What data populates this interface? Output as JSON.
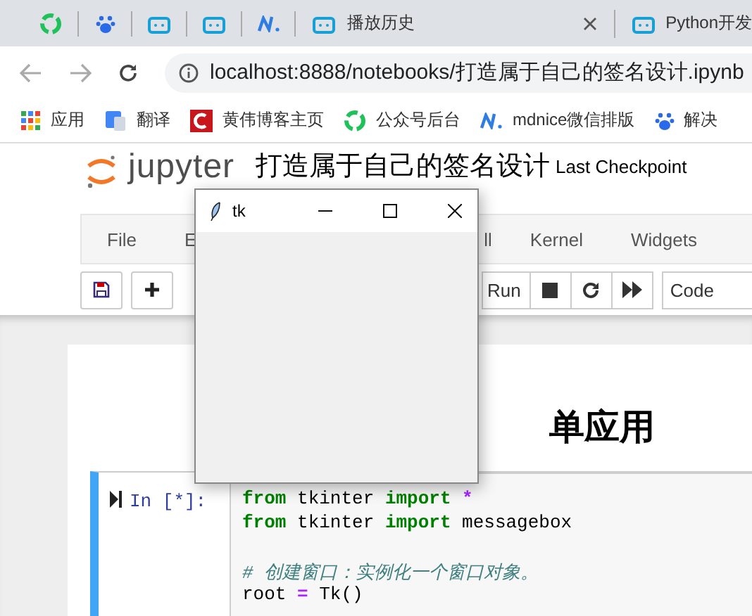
{
  "browser": {
    "tabs": [
      {
        "title": "播放历史"
      },
      {
        "title": "Python开发"
      }
    ],
    "url": "localhost:8888/notebooks/打造属于自己的签名设计.ipynb",
    "bookmarks": [
      "应用",
      "翻译",
      "黄伟博客主页",
      "公众号后台",
      "mdnice微信排版",
      "解决"
    ]
  },
  "notebook": {
    "logo": "jupyter",
    "title": "打造属于自己的签名设计",
    "checkpoint": "Last Checkpoint",
    "menu": [
      "File",
      "E",
      "ll",
      "Kernel",
      "Widgets"
    ],
    "toolbar": {
      "run": "Run",
      "cell_type": "Code"
    },
    "heading": "单应用",
    "cell": {
      "prompt": "In [*]:",
      "blocks": [
        [
          [
            {
              "text": "from",
              "kind": "keyword"
            },
            {
              "text": " tkinter ",
              "kind": "plain"
            },
            {
              "text": "import",
              "kind": "keyword"
            },
            {
              "text": " *",
              "kind": "operator"
            }
          ],
          [
            {
              "text": "from",
              "kind": "keyword"
            },
            {
              "text": " tkinter ",
              "kind": "plain"
            },
            {
              "text": "import",
              "kind": "keyword"
            },
            {
              "text": " messagebox",
              "kind": "plain"
            }
          ]
        ],
        [
          [
            {
              "text": "# 创建窗口：实例化一个窗口对象。",
              "kind": "comment"
            }
          ],
          [
            {
              "text": "root ",
              "kind": "plain"
            },
            {
              "text": "=",
              "kind": "operator"
            },
            {
              "text": " Tk()",
              "kind": "plain"
            }
          ]
        ]
      ]
    }
  },
  "tk_window": {
    "title": "tk"
  }
}
